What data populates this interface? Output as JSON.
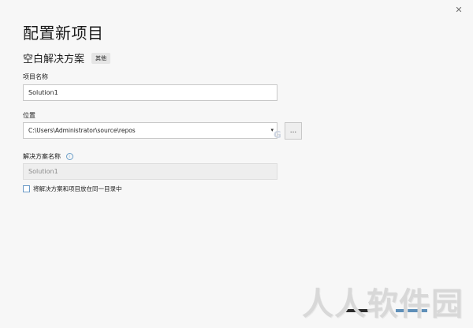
{
  "window": {
    "close_glyph": "✕"
  },
  "page": {
    "title": "配置新项目",
    "template_name": "空白解决方案",
    "template_tag": "其他"
  },
  "fields": {
    "project_name_label": "项目名称",
    "project_name_value": "Solution1",
    "location_label": "位置",
    "location_value": "C:\\Users\\Administrator\\source\\repos",
    "location_arrow": "▾",
    "browse_label": "...",
    "solution_name_label": "解决方案名称",
    "info_glyph": "i",
    "solution_name_value": "Solution1",
    "same_dir_checkbox_label": "将解决方案和项目放在同一目录中",
    "same_dir_checked": false
  },
  "overlay": {
    "faint_mark": "G",
    "watermark": "人人软件园"
  },
  "colors": {
    "accent": "#6c9bc7",
    "background": "#f7f7f7"
  }
}
